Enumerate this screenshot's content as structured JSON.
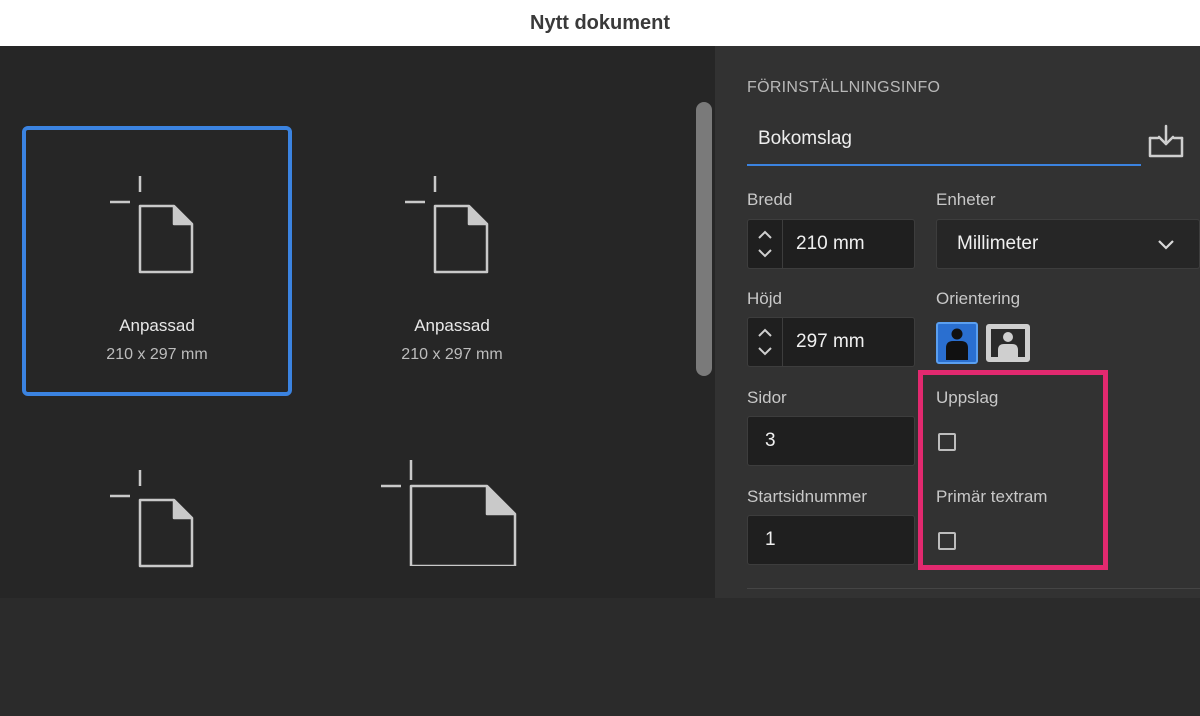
{
  "window": {
    "title": "Nytt dokument"
  },
  "presets": {
    "tiles": [
      {
        "name": "Anpassad",
        "size": "210 x 297 mm",
        "selected": true
      },
      {
        "name": "Anpassad",
        "size": "210 x 297 mm",
        "selected": false
      },
      {
        "name": "",
        "size": ""
      },
      {
        "name": "",
        "size": ""
      }
    ]
  },
  "details": {
    "section_title": "FÖRINSTÄLLNINGSINFO",
    "preset_name": "Bokomslag",
    "save_icon": "save-preset-icon",
    "width": {
      "label": "Bredd",
      "value": "210 mm"
    },
    "units": {
      "label": "Enheter",
      "value": "Millimeter"
    },
    "height": {
      "label": "Höjd",
      "value": "297 mm"
    },
    "orientation": {
      "label": "Orientering",
      "selected": "portrait"
    },
    "pages": {
      "label": "Sidor",
      "value": "3"
    },
    "facing_pages": {
      "label": "Uppslag",
      "checked": false
    },
    "start_page": {
      "label": "Startsidnummer",
      "value": "1"
    },
    "primary_text_frame": {
      "label": "Primär textram",
      "checked": false
    }
  },
  "colors": {
    "accent": "#3b83e0",
    "highlight": "#e2296f"
  }
}
